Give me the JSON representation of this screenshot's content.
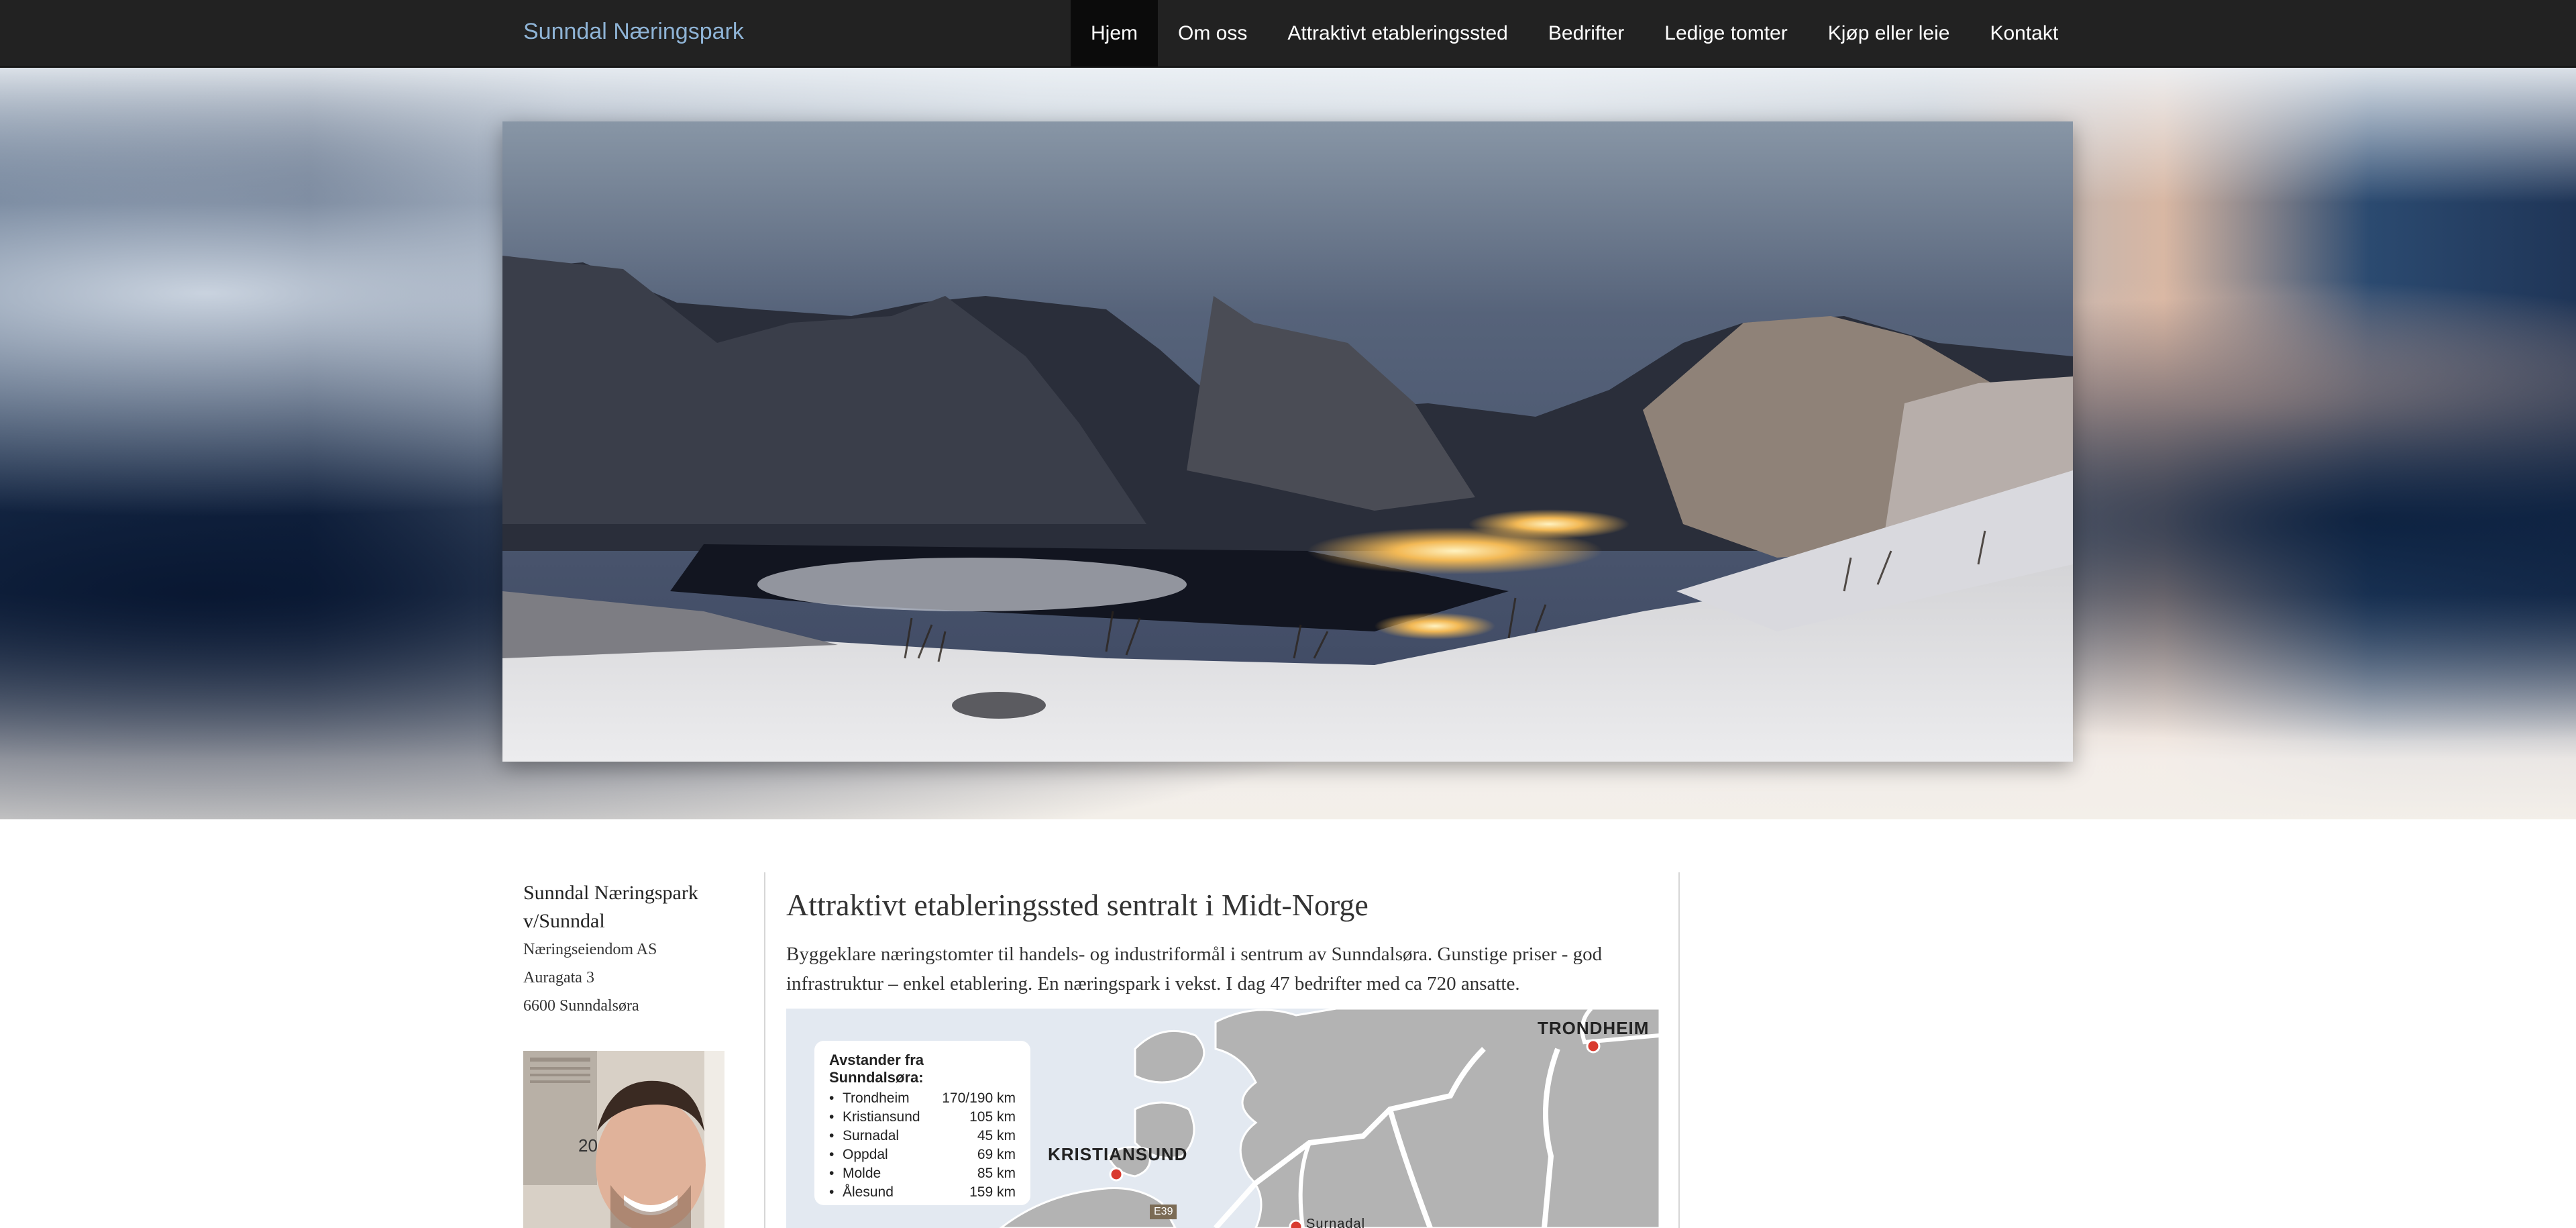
{
  "site": {
    "brand": "Sunndal Næringspark",
    "nav": [
      {
        "label": "Hjem",
        "active": true
      },
      {
        "label": "Om oss"
      },
      {
        "label": "Attraktivt etableringssted"
      },
      {
        "label": "Bedrifter"
      },
      {
        "label": "Ledige tomter"
      },
      {
        "label": "Kjøp eller leie"
      },
      {
        "label": "Kontakt"
      }
    ]
  },
  "sidebar": {
    "company_line1": "Sunndal Næringspark",
    "company_line2": "v/Sunndal",
    "company_line3": "Næringseiendom AS",
    "address": "Auragata 3",
    "postal": "6600 Sunndalsøra",
    "calendar_year": "20"
  },
  "main": {
    "headline": "Attraktivt etableringssted sentralt i Midt-Norge",
    "lead": "Byggeklare næringstomter til handels- og industriformål i sentrum av Sunndalsøra. Gunstige priser - god infrastruktur – enkel etablering. En næringspark i vekst. I dag 47 bedrifter med ca 720 ansatte."
  },
  "map": {
    "title": "Avstander fra Sunndalsøra:",
    "distances": [
      {
        "name": "Trondheim",
        "dist": "170/190 km"
      },
      {
        "name": "Kristiansund",
        "dist": "105 km"
      },
      {
        "name": "Surnadal",
        "dist": "45 km"
      },
      {
        "name": "Oppdal",
        "dist": "69 km"
      },
      {
        "name": "Molde",
        "dist": "85 km"
      },
      {
        "name": "Ålesund",
        "dist": "159 km"
      }
    ],
    "city_trondheim": "TRONDHEIM",
    "city_kristiansund": "KRISTIANSUND",
    "road_label": "E39",
    "city_partial": "Surnadal"
  },
  "colors": {
    "navbar_bg": "#222222",
    "brand_color": "#8fb4d6",
    "map_land": "#b3b3b3",
    "map_sea": "#e3e9f1",
    "city_dot": "#d93a2f"
  }
}
